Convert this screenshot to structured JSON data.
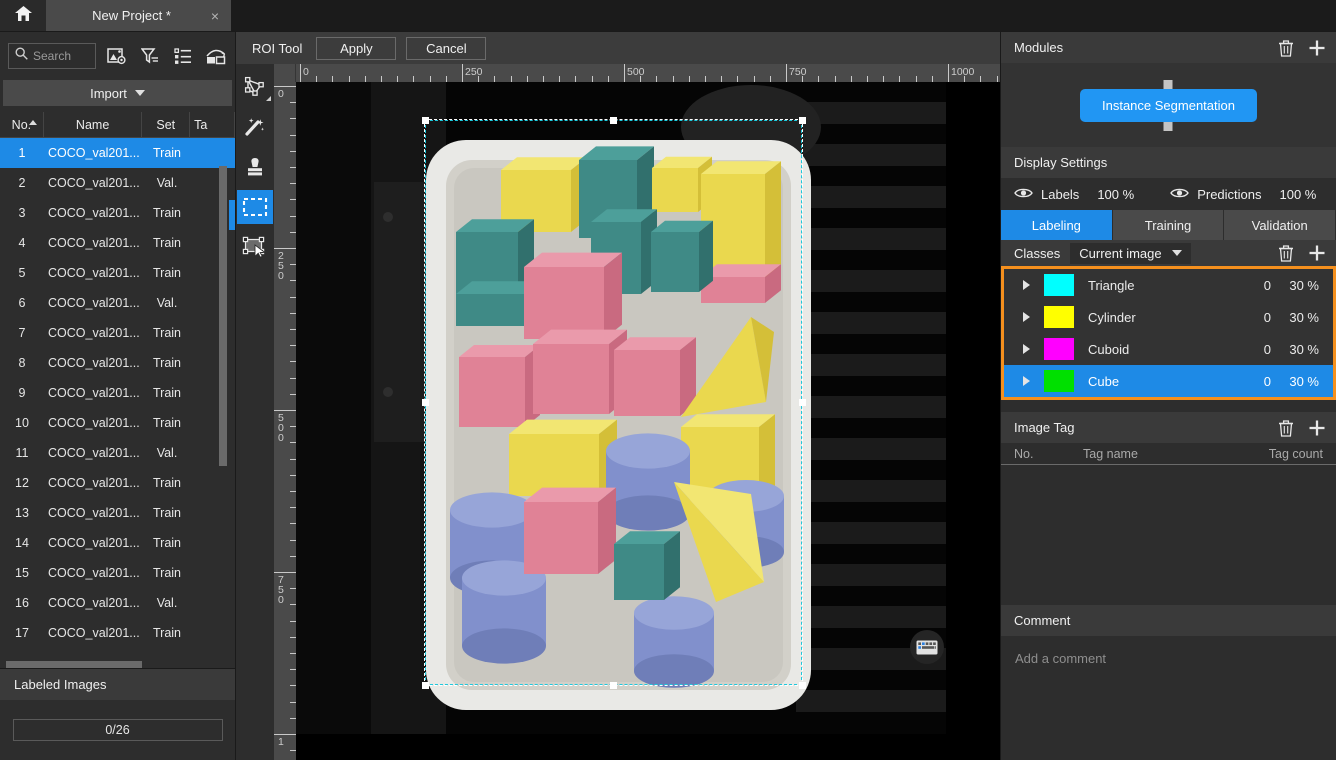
{
  "titlebar": {
    "home_icon": "home-icon",
    "tab_label": "New Project *",
    "tab_close": "×"
  },
  "left_panel": {
    "search": {
      "placeholder": "Search",
      "value": "",
      "icon": "search-icon"
    },
    "toolbar_icons": [
      "image-settings-icon",
      "filter-icon",
      "list-view-icon",
      "compare-view-icon"
    ],
    "import_label": "Import",
    "table": {
      "columns": [
        "No.",
        "Name",
        "Set",
        "Ta"
      ],
      "rows": [
        {
          "no": "1",
          "name": "COCO_val201...",
          "set": "Train"
        },
        {
          "no": "2",
          "name": "COCO_val201...",
          "set": "Val."
        },
        {
          "no": "3",
          "name": "COCO_val201...",
          "set": "Train"
        },
        {
          "no": "4",
          "name": "COCO_val201...",
          "set": "Train"
        },
        {
          "no": "5",
          "name": "COCO_val201...",
          "set": "Train"
        },
        {
          "no": "6",
          "name": "COCO_val201...",
          "set": "Val."
        },
        {
          "no": "7",
          "name": "COCO_val201...",
          "set": "Train"
        },
        {
          "no": "8",
          "name": "COCO_val201...",
          "set": "Train"
        },
        {
          "no": "9",
          "name": "COCO_val201...",
          "set": "Train"
        },
        {
          "no": "10",
          "name": "COCO_val201...",
          "set": "Train"
        },
        {
          "no": "11",
          "name": "COCO_val201...",
          "set": "Val."
        },
        {
          "no": "12",
          "name": "COCO_val201...",
          "set": "Train"
        },
        {
          "no": "13",
          "name": "COCO_val201...",
          "set": "Train"
        },
        {
          "no": "14",
          "name": "COCO_val201...",
          "set": "Train"
        },
        {
          "no": "15",
          "name": "COCO_val201...",
          "set": "Train"
        },
        {
          "no": "16",
          "name": "COCO_val201...",
          "set": "Val."
        },
        {
          "no": "17",
          "name": "COCO_val201...",
          "set": "Train"
        }
      ],
      "selected_index": 0
    },
    "labeled_images": {
      "title": "Labeled Images",
      "progress": "0/26"
    }
  },
  "canvas": {
    "roi_tool_label": "ROI Tool",
    "apply_label": "Apply",
    "cancel_label": "Cancel",
    "tools": [
      {
        "name": "polygon-tool",
        "active": false
      },
      {
        "name": "magic-wand-tool",
        "active": false
      },
      {
        "name": "stamp-tool",
        "active": false
      },
      {
        "name": "rectangle-select-tool",
        "active": true
      },
      {
        "name": "transform-tool",
        "active": false
      }
    ],
    "ruler_h_labels": [
      "0",
      "250",
      "500",
      "750",
      "1000"
    ],
    "ruler_v_labels": [
      "0",
      "250",
      "500",
      "750",
      "1"
    ],
    "keyboard_icon": "keyboard-icon"
  },
  "right_panel": {
    "modules": {
      "title": "Modules",
      "delete_icon": "trash-icon",
      "add_icon": "plus-icon",
      "node_label": "Instance Segmentation"
    },
    "display_settings": {
      "title": "Display Settings",
      "labels_label": "Labels",
      "labels_value": "100 %",
      "predictions_label": "Predictions",
      "predictions_value": "100 %",
      "eye_icon": "eye-icon"
    },
    "tabs": [
      {
        "label": "Labeling",
        "active": true
      },
      {
        "label": "Training",
        "active": false
      },
      {
        "label": "Validation",
        "active": false
      }
    ],
    "classes": {
      "title": "Classes",
      "scope": "Current image",
      "delete_icon": "trash-icon",
      "add_icon": "plus-icon",
      "highlight_color": "#f5901e",
      "items": [
        {
          "name": "Triangle",
          "color": "#00ffff",
          "count": "0",
          "percent": "30 %",
          "selected": false
        },
        {
          "name": "Cylinder",
          "color": "#ffff00",
          "count": "0",
          "percent": "30 %",
          "selected": false
        },
        {
          "name": "Cuboid",
          "color": "#ff00ff",
          "count": "0",
          "percent": "30 %",
          "selected": false
        },
        {
          "name": "Cube",
          "color": "#00e000",
          "count": "0",
          "percent": "30 %",
          "selected": true
        }
      ]
    },
    "image_tag": {
      "title": "Image Tag",
      "delete_icon": "trash-icon",
      "add_icon": "plus-icon",
      "columns": [
        "No.",
        "Tag name",
        "Tag count"
      ],
      "rows": []
    },
    "comment": {
      "title": "Comment",
      "placeholder": "Add a comment",
      "value": ""
    }
  },
  "colors": {
    "accent_blue": "#1e8ae6",
    "highlight_orange": "#f5901e",
    "panel_bg": "#2d2d2d",
    "header_bg": "#3a3a3a"
  }
}
